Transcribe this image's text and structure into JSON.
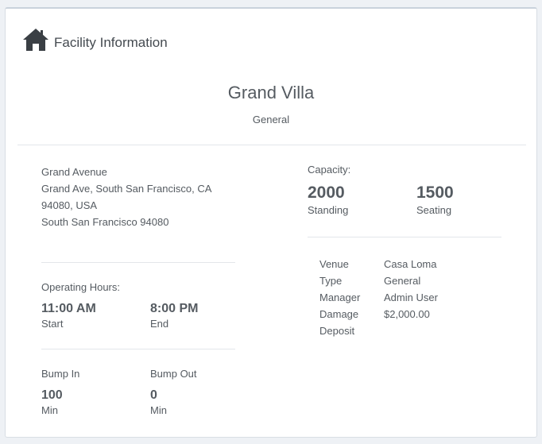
{
  "header": {
    "title": "Facility Information",
    "icon": "home-icon"
  },
  "venue": {
    "name": "Grand Villa",
    "type": "General"
  },
  "address": {
    "lines": [
      "Grand Avenue",
      "Grand Ave, South San Francisco, CA",
      "94080, USA",
      "South San Francisco 94080"
    ]
  },
  "operating_hours": {
    "label": "Operating Hours:",
    "start_value": "11:00 AM",
    "start_caption": "Start",
    "end_value": "8:00 PM",
    "end_caption": "End"
  },
  "bump": {
    "in_label": "Bump In",
    "in_value": "100",
    "in_unit": "Min",
    "out_label": "Bump Out",
    "out_value": "0",
    "out_unit": "Min"
  },
  "capacity": {
    "label": "Capacity:",
    "standing_value": "2000",
    "standing_caption": "Standing",
    "seating_value": "1500",
    "seating_caption": "Seating"
  },
  "details": [
    {
      "key": "Venue",
      "value": "Casa Loma"
    },
    {
      "key": "Type",
      "value": "General"
    },
    {
      "key": "Manager",
      "value": "Admin User"
    },
    {
      "key": "Damage",
      "value": "$2,000.00"
    },
    {
      "key": "Deposit",
      "value": ""
    }
  ],
  "colors": {
    "text": "#555b61",
    "divider": "#e3e6ea",
    "background": "#eef1f5"
  }
}
